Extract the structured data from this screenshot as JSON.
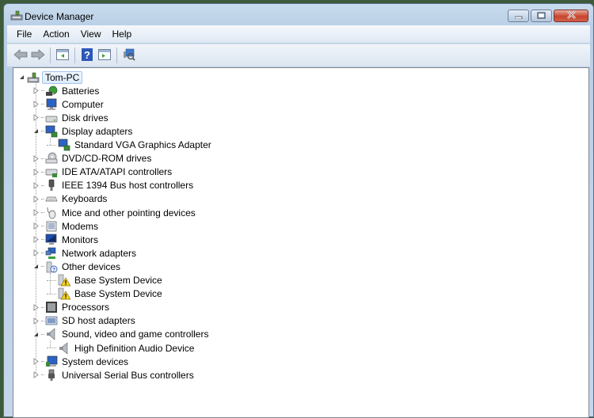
{
  "window": {
    "title": "Device Manager",
    "controls": {
      "minimize": "minimize-icon",
      "maximize": "maximize-icon",
      "close": "close-icon"
    }
  },
  "menu": [
    "File",
    "Action",
    "View",
    "Help"
  ],
  "toolbar": {
    "buttons": [
      "back-arrow-icon",
      "forward-arrow-icon",
      "show-hide-console-tree-icon",
      "help-icon",
      "show-action-pane-icon",
      "scan-hardware-changes-icon"
    ]
  },
  "tree": {
    "root": {
      "label": "Tom-PC",
      "expanded": true,
      "selected": true
    },
    "items": [
      {
        "label": "Batteries",
        "icon": "battery-icon",
        "expanded": false
      },
      {
        "label": "Computer",
        "icon": "computer-icon",
        "expanded": false
      },
      {
        "label": "Disk drives",
        "icon": "disk-drive-icon",
        "expanded": false
      },
      {
        "label": "Display adapters",
        "icon": "display-adapter-icon",
        "expanded": true,
        "children": [
          {
            "label": "Standard VGA Graphics Adapter",
            "icon": "display-adapter-icon"
          }
        ]
      },
      {
        "label": "DVD/CD-ROM drives",
        "icon": "dvd-drive-icon",
        "expanded": false
      },
      {
        "label": "IDE ATA/ATAPI controllers",
        "icon": "ide-controller-icon",
        "expanded": false
      },
      {
        "label": "IEEE 1394 Bus host controllers",
        "icon": "firewire-icon",
        "expanded": false
      },
      {
        "label": "Keyboards",
        "icon": "keyboard-icon",
        "expanded": false
      },
      {
        "label": "Mice and other pointing devices",
        "icon": "mouse-icon",
        "expanded": false
      },
      {
        "label": "Modems",
        "icon": "modem-icon",
        "expanded": false
      },
      {
        "label": "Monitors",
        "icon": "monitor-icon",
        "expanded": false
      },
      {
        "label": "Network adapters",
        "icon": "network-adapter-icon",
        "expanded": false
      },
      {
        "label": "Other devices",
        "icon": "unknown-device-icon",
        "expanded": true,
        "children": [
          {
            "label": "Base System Device",
            "icon": "warning-device-icon"
          },
          {
            "label": "Base System Device",
            "icon": "warning-device-icon"
          }
        ]
      },
      {
        "label": "Processors",
        "icon": "processor-icon",
        "expanded": false
      },
      {
        "label": "SD host adapters",
        "icon": "sd-host-icon",
        "expanded": false
      },
      {
        "label": "Sound, video and game controllers",
        "icon": "speaker-icon",
        "expanded": true,
        "children": [
          {
            "label": "High Definition Audio Device",
            "icon": "speaker-icon"
          }
        ]
      },
      {
        "label": "System devices",
        "icon": "system-device-icon",
        "expanded": false
      },
      {
        "label": "Universal Serial Bus controllers",
        "icon": "usb-icon",
        "expanded": false
      }
    ]
  }
}
